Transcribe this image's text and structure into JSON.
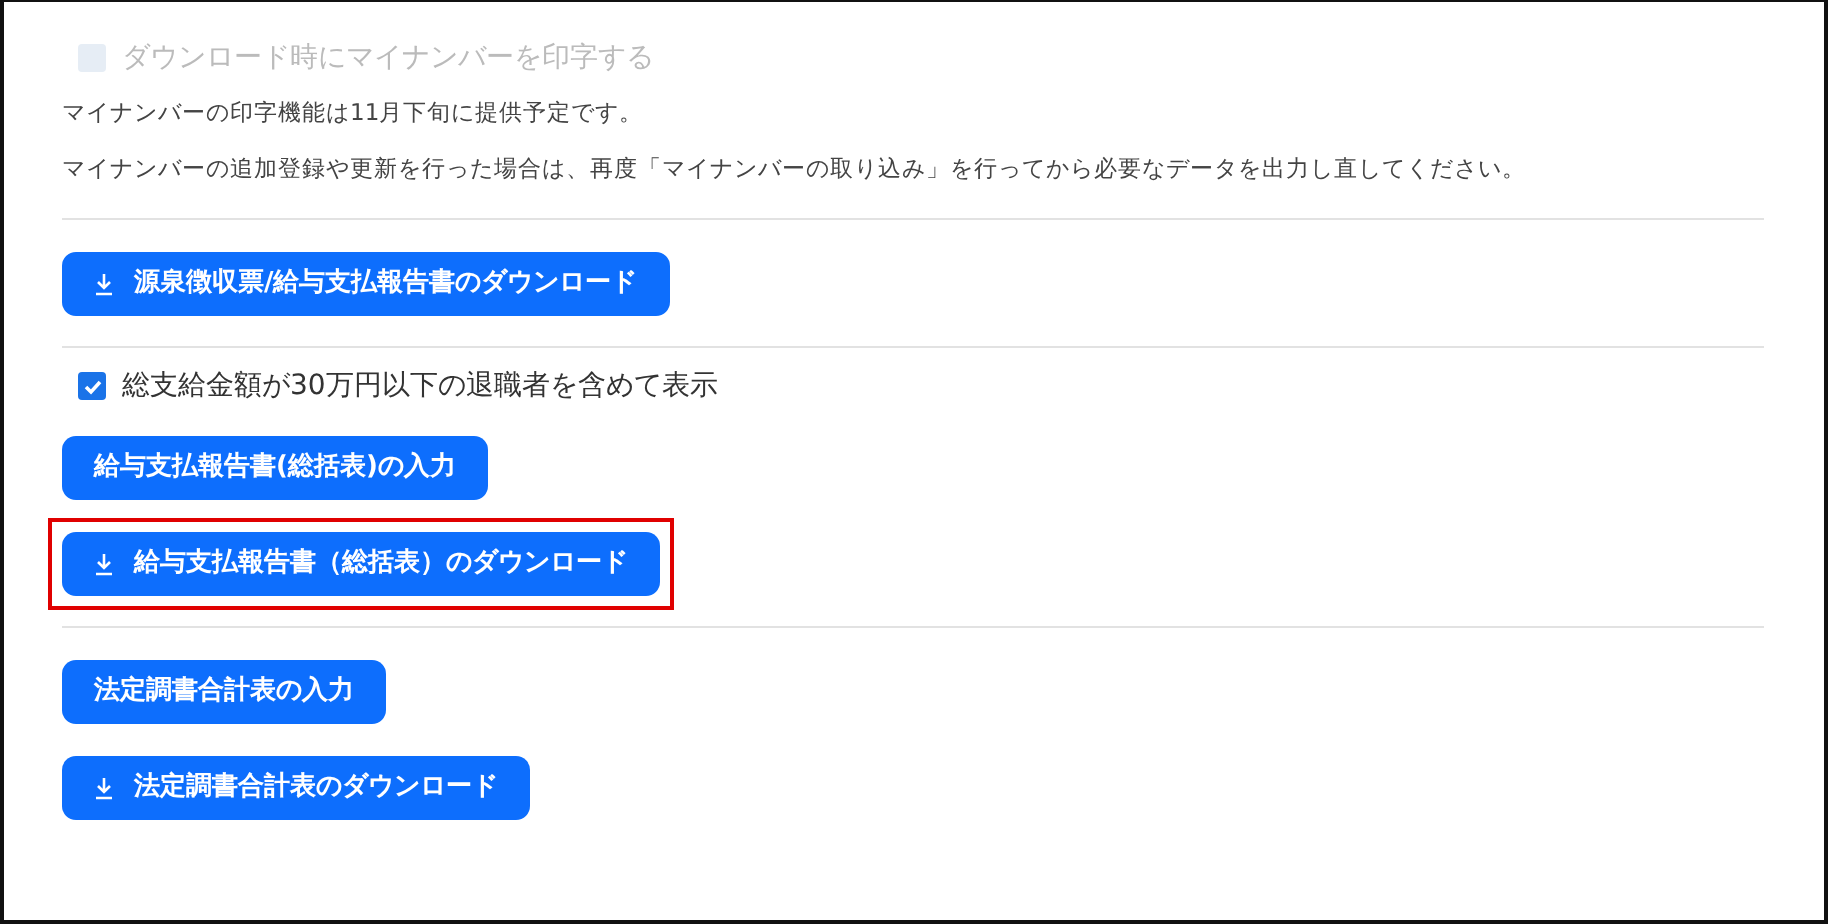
{
  "sections": [
    {
      "items": [
        {
          "kind": "checkbox",
          "label": "ダウンロード時にマイナンバーを印字する",
          "checked": false,
          "disabled": true
        },
        {
          "kind": "note",
          "text": "マイナンバーの印字機能は11月下旬に提供予定です。"
        },
        {
          "kind": "note",
          "text": "マイナンバーの追加登録や更新を行った場合は、再度「マイナンバーの取り込み」を行ってから必要なデータを出力し直してください。"
        }
      ]
    },
    {
      "items": [
        {
          "kind": "download_button",
          "label": "源泉徴収票/給与支払報告書のダウンロード",
          "highlighted": false
        }
      ]
    },
    {
      "items": [
        {
          "kind": "checkbox",
          "label": "総支給金額が30万円以下の退職者を含めて表示",
          "checked": true,
          "disabled": false
        },
        {
          "kind": "button",
          "label": "給与支払報告書(総括表)の入力",
          "highlighted": false
        },
        {
          "kind": "download_button",
          "label": "給与支払報告書（総括表）のダウンロード",
          "highlighted": true
        }
      ]
    },
    {
      "items": [
        {
          "kind": "button",
          "label": "法定調書合計表の入力",
          "highlighted": false
        },
        {
          "kind": "download_button",
          "label": "法定調書合計表のダウンロード",
          "highlighted": false
        }
      ]
    }
  ]
}
